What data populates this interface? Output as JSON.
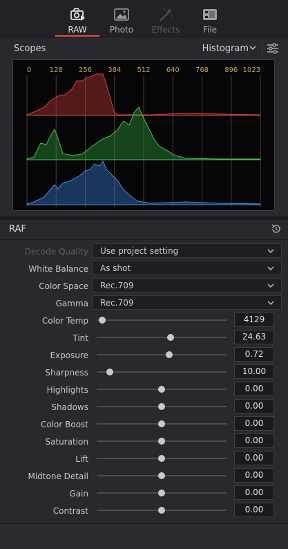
{
  "tabs": [
    {
      "label": "RAW",
      "icon": "camera-raw-icon",
      "state": "active"
    },
    {
      "label": "Photo",
      "icon": "photo-icon",
      "state": "normal"
    },
    {
      "label": "Effects",
      "icon": "magic-wand-icon",
      "state": "disabled"
    },
    {
      "label": "File",
      "icon": "file-film-icon",
      "state": "normal"
    }
  ],
  "scopes": {
    "title": "Scopes",
    "mode": "Histogram",
    "ticks": [
      "0",
      "128",
      "256",
      "384",
      "512",
      "640",
      "768",
      "896",
      "1023"
    ],
    "channel_colors": {
      "red": "#c0403c",
      "green": "#3fc04a",
      "blue": "#3d7fd0"
    }
  },
  "raf": {
    "title": "RAF",
    "dropdowns": [
      {
        "label": "Decode Quality",
        "value": "Use project setting",
        "enabled": false
      },
      {
        "label": "White Balance",
        "value": "As shot",
        "enabled": true
      },
      {
        "label": "Color Space",
        "value": "Rec.709",
        "enabled": true
      },
      {
        "label": "Gamma",
        "value": "Rec.709",
        "enabled": true
      }
    ],
    "sliders": [
      {
        "label": "Color Temp",
        "value": "4129",
        "level": 0.04
      },
      {
        "label": "Tint",
        "value": "24.63",
        "level": 0.57
      },
      {
        "label": "Exposure",
        "value": "0.72",
        "level": 0.56
      },
      {
        "label": "Sharpness",
        "value": "10.00",
        "level": 0.1
      },
      {
        "label": "Highlights",
        "value": "0.00",
        "level": 0.5
      },
      {
        "label": "Shadows",
        "value": "0.00",
        "level": 0.5
      },
      {
        "label": "Color Boost",
        "value": "0.00",
        "level": 0.5
      },
      {
        "label": "Saturation",
        "value": "0.00",
        "level": 0.5
      },
      {
        "label": "Lift",
        "value": "0.00",
        "level": 0.5
      },
      {
        "label": "Midtone Detail",
        "value": "0.00",
        "level": 0.5
      },
      {
        "label": "Gain",
        "value": "0.00",
        "level": 0.5
      },
      {
        "label": "Contrast",
        "value": "0.00",
        "level": 0.5
      }
    ]
  },
  "colors": {
    "accent": "#e2523f",
    "panel": "#28282e"
  }
}
